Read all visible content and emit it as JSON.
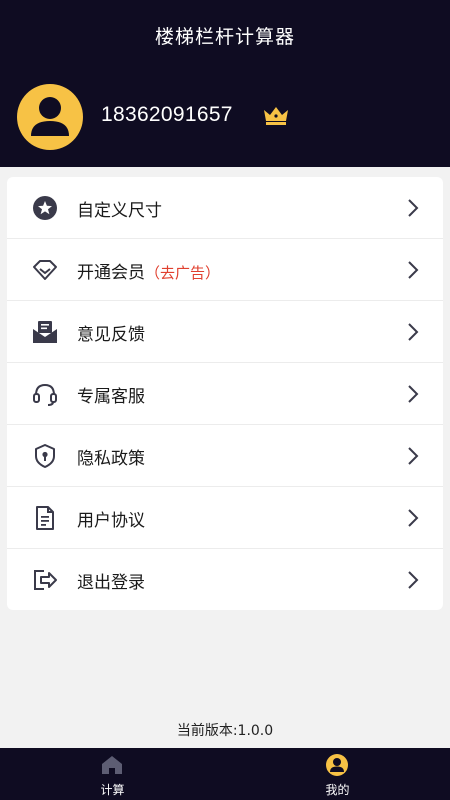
{
  "header": {
    "title": "楼梯栏杆计算器",
    "phone": "18362091657"
  },
  "menu": [
    {
      "label": "自定义尺寸",
      "sub": "",
      "icon": "star-badge-icon"
    },
    {
      "label": "开通会员",
      "sub": "（去广告）",
      "icon": "diamond-icon"
    },
    {
      "label": "意见反馈",
      "sub": "",
      "icon": "mail-feedback-icon"
    },
    {
      "label": "专属客服",
      "sub": "",
      "icon": "headset-icon"
    },
    {
      "label": "隐私政策",
      "sub": "",
      "icon": "shield-lock-icon"
    },
    {
      "label": "用户协议",
      "sub": "",
      "icon": "document-icon"
    },
    {
      "label": "退出登录",
      "sub": "",
      "icon": "logout-icon"
    }
  ],
  "footer": {
    "version": "当前版本:1.0.0"
  },
  "tabs": [
    {
      "label": "计算",
      "icon": "home-icon",
      "active": false
    },
    {
      "label": "我的",
      "icon": "user-icon",
      "active": true
    }
  ],
  "colors": {
    "header_bg": "#0f0c22",
    "accent_gold": "#f7c245",
    "promo_red": "#e0402f",
    "icon_dark": "#3a3a4a"
  }
}
